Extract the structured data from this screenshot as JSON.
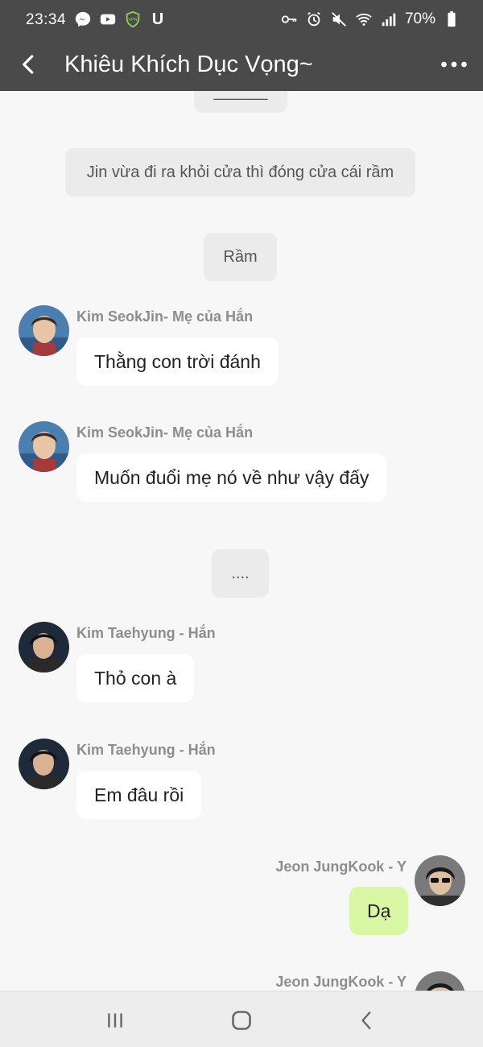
{
  "status_bar": {
    "time": "23:34",
    "battery": "70%",
    "icons_left": [
      "messenger-icon",
      "youtube-icon",
      "vpn-icon",
      "u-icon"
    ],
    "icons_right": [
      "key-icon",
      "alarm-icon",
      "mute-icon",
      "wifi-icon",
      "signal-icon",
      "battery-icon"
    ],
    "vpn_text": "VPN",
    "u_text": "U"
  },
  "header": {
    "title": "Khiêu Khích Dục Vọng~"
  },
  "messages": {
    "top_divider": "______",
    "sys1": "Jin vừa đi ra khỏi cửa thì đóng cửa cái rầm",
    "sys2": "Rầm",
    "m1_sender": "Kim SeokJin- Mẹ của Hắn",
    "m1_text": "Thằng con trời đánh",
    "m2_sender": "Kim SeokJin- Mẹ của Hắn",
    "m2_text": "Muốn đuổi mẹ nó về như vậy đấy",
    "sys3": "....",
    "m3_sender": "Kim Taehyung - Hắn",
    "m3_text": "Thỏ con à",
    "m4_sender": "Kim Taehyung - Hắn",
    "m4_text": "Em đâu rồi",
    "m5_sender": "Jeon JungKook - Y",
    "m5_text": "Dạ",
    "m6_sender": "Jeon JungKook - Y"
  },
  "colors": {
    "header_bg": "#4a4a4a",
    "chat_bg": "#f7f7f7",
    "system_bubble": "#ebebeb",
    "incoming_bubble": "#ffffff",
    "outgoing_bubble": "#d9f7a5",
    "sender_text": "#8d8d8d"
  },
  "navbar": {
    "icons": [
      "recent-apps-icon",
      "home-icon",
      "back-nav-icon"
    ]
  }
}
